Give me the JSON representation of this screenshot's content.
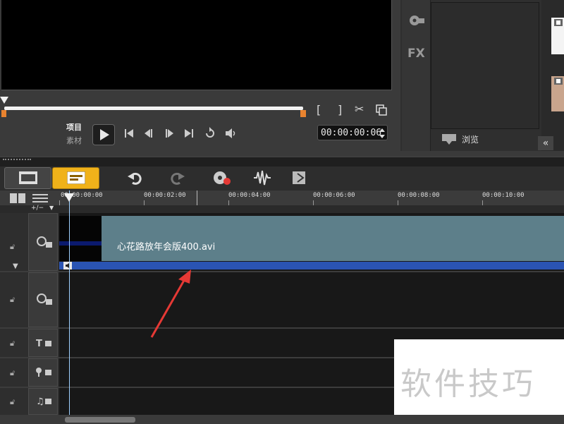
{
  "player": {
    "mode_project": "项目",
    "mode_clip": "素材",
    "timecode": "00:00:00:06"
  },
  "side": {
    "fx_label": "FX",
    "browse_label": "浏览",
    "collapse_label": "«"
  },
  "ruler": {
    "ticks": [
      "00:00:00:00",
      "00:00:02:00",
      "00:00:04:00",
      "00:00:06:00",
      "00:00:08:00",
      "00:00:10:00"
    ],
    "zoom_label": "+/−"
  },
  "timeline": {
    "clip_name": "心花路放年会版400.avi"
  },
  "watermark": {
    "text": "软件技巧"
  },
  "colors": {
    "accent_tab": "#f0b21a",
    "clip": "#5d7f8a",
    "audio": "#2a54b3",
    "arrow": "#e53935"
  }
}
